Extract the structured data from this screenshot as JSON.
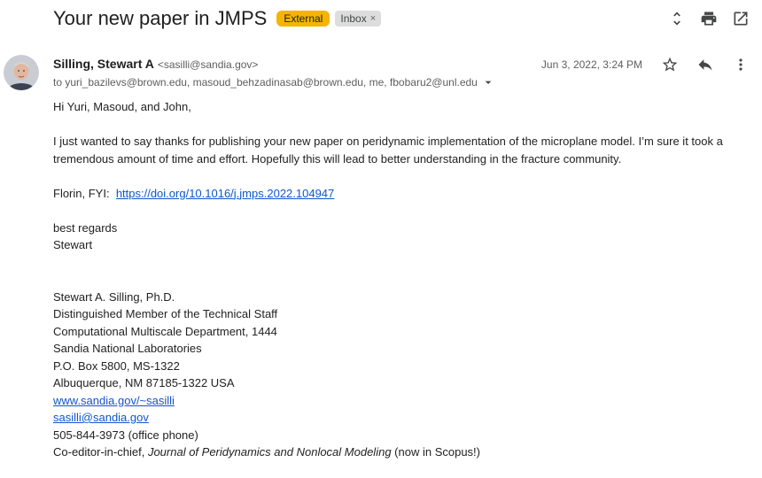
{
  "header": {
    "subject": "Your new paper in JMPS",
    "labels": {
      "external": "External",
      "inbox": "Inbox",
      "inbox_remove": "×"
    },
    "icons": [
      "expand-collapse-icon",
      "print-icon",
      "open-in-new-window-icon"
    ]
  },
  "message": {
    "sender_name": "Silling, Stewart A",
    "sender_email": "<sasilli@sandia.gov>",
    "recipients": "to yuri_bazilevs@brown.edu, masoud_behzadinasab@brown.edu, me, fbobaru2@unl.edu",
    "date": "Jun 3, 2022, 3:24 PM",
    "icons": [
      "star-icon",
      "reply-icon",
      "more-vert-icon"
    ]
  },
  "body": {
    "greeting": "Hi Yuri, Masoud, and John,",
    "para1": "I just wanted to say thanks for publishing your new paper on peridynamic implementation of the microplane model. I’m sure it took a tremendous amount of time and effort. Hopefully this will lead to better understanding in the fracture community.",
    "fyi_prefix": "Florin, FYI:",
    "fyi_link": "https://doi.org/10.1016/j.jmps.2022.104947",
    "closing": "best regards",
    "name": "Stewart"
  },
  "signature": {
    "line1": "Stewart A. Silling, Ph.D.",
    "line2": "Distinguished Member of the Technical Staff",
    "line3": "Computational Multiscale Department, 1444",
    "line4": "Sandia National Laboratories",
    "line5": "P.O. Box 5800, MS-1322",
    "line6": "Albuquerque, NM 87185-1322 USA",
    "website": "www.sandia.gov/~sasilli",
    "email": "sasilli@sandia.gov",
    "phone": "505-844-3973 (office phone)",
    "editor_prefix": "Co-editor-in-chief,",
    "journal": "Journal of Peridynamics and Nonlocal Modeling",
    "editor_suffix": "(now in Scopus!)"
  }
}
